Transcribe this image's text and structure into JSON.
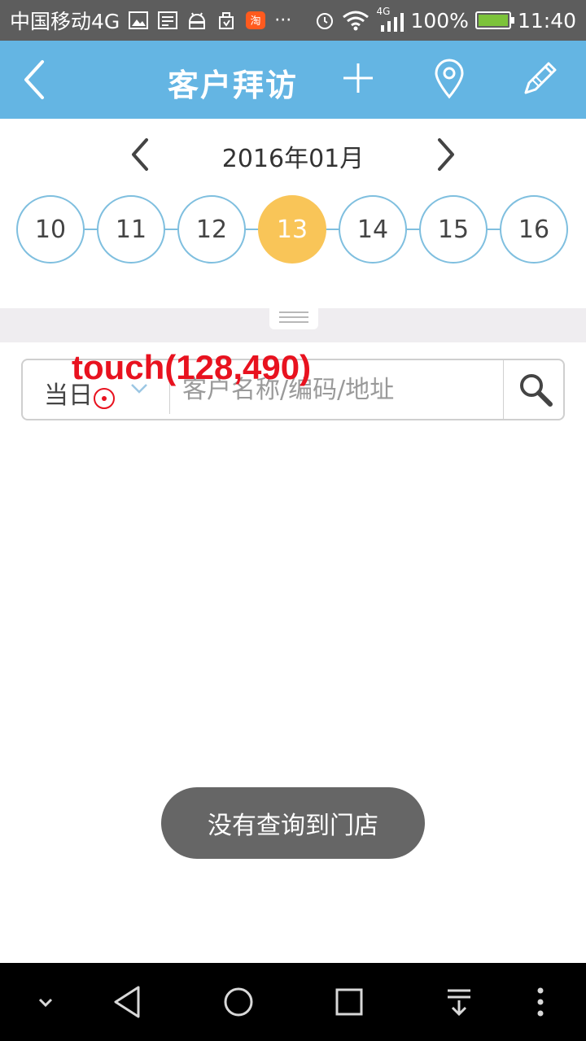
{
  "status_bar": {
    "carrier": "中国移动4G",
    "more": "···",
    "network_badge": "4G",
    "battery": "100%",
    "time": "11:40",
    "icons": [
      "image-icon",
      "message-icon",
      "android-icon",
      "cleaner-icon",
      "taobao-icon",
      "alarm-icon",
      "wifi-icon",
      "signal-icon",
      "battery-icon"
    ]
  },
  "title_bar": {
    "title": "客户拜访",
    "icons": [
      "back-icon",
      "add-icon",
      "location-icon",
      "edit-icon"
    ]
  },
  "calendar": {
    "month_label": "2016年01月",
    "days": [
      "10",
      "11",
      "12",
      "13",
      "14",
      "15",
      "16"
    ],
    "selected_day": "13"
  },
  "search": {
    "filter_label": "当日",
    "placeholder": "客户名称/编码/地址"
  },
  "overlay": {
    "touch_label": "touch(128,490)"
  },
  "toast": {
    "message": "没有查询到门店"
  },
  "colors": {
    "title_bar": "#64b5e3",
    "status_bar": "#5d5d5d",
    "selected_day": "#f9c558",
    "day_border": "#7fbfdf",
    "toast_bg": "#666666",
    "touch_overlay": "#e8121f"
  },
  "nav_bar": {
    "icons": [
      "collapse-icon",
      "back-triangle-icon",
      "home-circle-icon",
      "recents-square-icon",
      "notification-pull-icon",
      "menu-dots-icon"
    ]
  }
}
